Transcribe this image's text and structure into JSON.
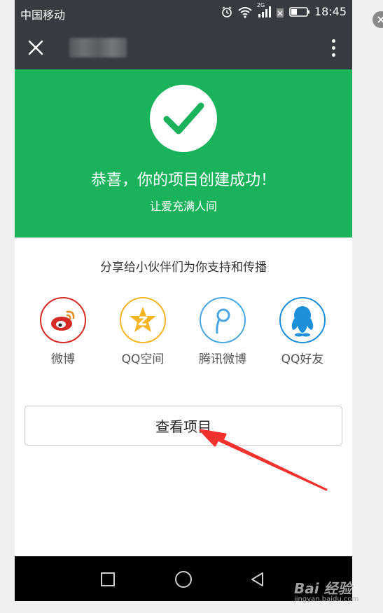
{
  "status_bar": {
    "carrier": "中国移动",
    "network": "2G",
    "time": "18:45",
    "icons": [
      "alarm-icon",
      "wifi-icon",
      "signal-icon",
      "no-sim-icon",
      "battery-icon"
    ]
  },
  "app_bar": {
    "icons": [
      "close-icon",
      "more-vertical-icon"
    ]
  },
  "banner": {
    "title": "恭喜，你的项目创建成功！",
    "subtitle": "让爱充满人间",
    "icon": "checkmark-icon",
    "bg_color": "#1ab35b"
  },
  "share": {
    "heading": "分享给小伙伴们为你支持和传播",
    "items": [
      {
        "label": "微博",
        "icon": "weibo-icon",
        "color": "#d52a26"
      },
      {
        "label": "QQ空间",
        "icon": "qzone-icon",
        "color": "#f5b524"
      },
      {
        "label": "腾讯微博",
        "icon": "tencent-weibo-icon",
        "color": "#4aa8e0"
      },
      {
        "label": "QQ好友",
        "icon": "qq-icon",
        "color": "#1d8fd8"
      }
    ]
  },
  "view_button": {
    "label": "查看项目"
  },
  "nav_bar": {
    "icons": [
      "recent-apps-icon",
      "home-icon",
      "back-icon"
    ]
  },
  "annotation": {
    "arrow_color": "#f0312e"
  },
  "watermark": {
    "brand": "Bai 经验",
    "site": "jingyan.baidu.com"
  }
}
